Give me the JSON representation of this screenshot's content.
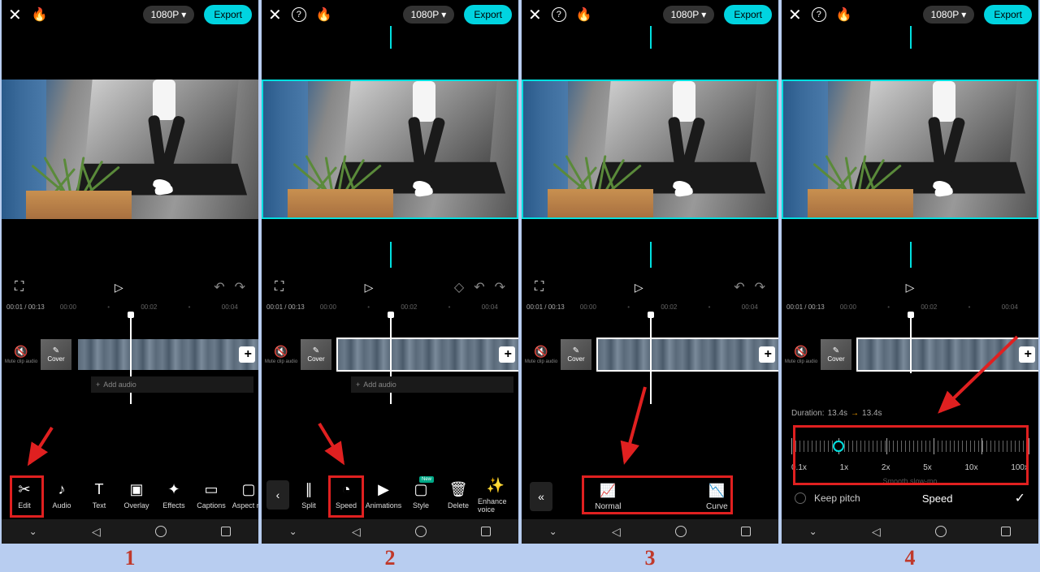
{
  "topbar": {
    "resolution": "1080P",
    "export": "Export"
  },
  "time": {
    "current": "00:01",
    "total": "00:13",
    "ticks": [
      "00:00",
      "00:02",
      "00:04"
    ]
  },
  "track": {
    "mute": "Mute clip audio",
    "cover": "Cover",
    "add_audio": "Add audio"
  },
  "panel1": {
    "tools": [
      "Edit",
      "Audio",
      "Text",
      "Overlay",
      "Effects",
      "Captions",
      "Aspect rat"
    ]
  },
  "panel2": {
    "tools": [
      "Split",
      "Speed",
      "Animations",
      "Style",
      "Delete",
      "Enhance voice"
    ],
    "new_badge": "New"
  },
  "panel3": {
    "normal": "Normal",
    "curve": "Curve"
  },
  "panel4": {
    "duration_label": "Duration:",
    "dur_from": "13.4s",
    "dur_to": "13.4s",
    "speeds": [
      "0.1x",
      "1x",
      "2x",
      "5x",
      "10x",
      "100x"
    ],
    "smooth": "Smooth slow-mo",
    "keep_pitch": "Keep pitch",
    "title": "Speed"
  },
  "steps": [
    "1",
    "2",
    "3",
    "4"
  ]
}
